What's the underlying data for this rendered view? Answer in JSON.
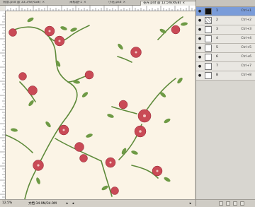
{
  "tabs": [
    {
      "label": "背景.psd @ 33.3%(RGB)",
      "active": false
    },
    {
      "label": "未标题-1",
      "active": false
    },
    {
      "label": "小花.psd",
      "active": false
    },
    {
      "label": "花卉.psd @ 12.5%(RGB)",
      "active": true
    }
  ],
  "status": {
    "zoom": "12.5%",
    "doc": "文档:34.9M/34.9M"
  },
  "layers": [
    {
      "name": "1",
      "shortcut": "Ctrl+1",
      "thumb": "black",
      "selected": true
    },
    {
      "name": "2",
      "shortcut": "Ctrl+2",
      "thumb": "pattern",
      "selected": false
    },
    {
      "name": "3",
      "shortcut": "Ctrl+3",
      "thumb": "white",
      "selected": false
    },
    {
      "name": "4",
      "shortcut": "Ctrl+4",
      "thumb": "white",
      "selected": false
    },
    {
      "name": "5",
      "shortcut": "Ctrl+5",
      "thumb": "white",
      "selected": false
    },
    {
      "name": "6",
      "shortcut": "Ctrl+6",
      "thumb": "white",
      "selected": false
    },
    {
      "name": "7",
      "shortcut": "Ctrl+7",
      "thumb": "white",
      "selected": false
    },
    {
      "name": "8",
      "shortcut": "Ctrl+8",
      "thumb": "white",
      "selected": false
    }
  ],
  "colors": {
    "canvas_bg": "#fbf4e6",
    "flower": "#c94a56",
    "flower_dark": "#8f2233",
    "stem": "#5e8a3a",
    "leaf": "#6e9a45",
    "selected_layer": "#7a9cd9"
  },
  "icons": {
    "eye": "eye-icon",
    "close": "close-icon"
  }
}
